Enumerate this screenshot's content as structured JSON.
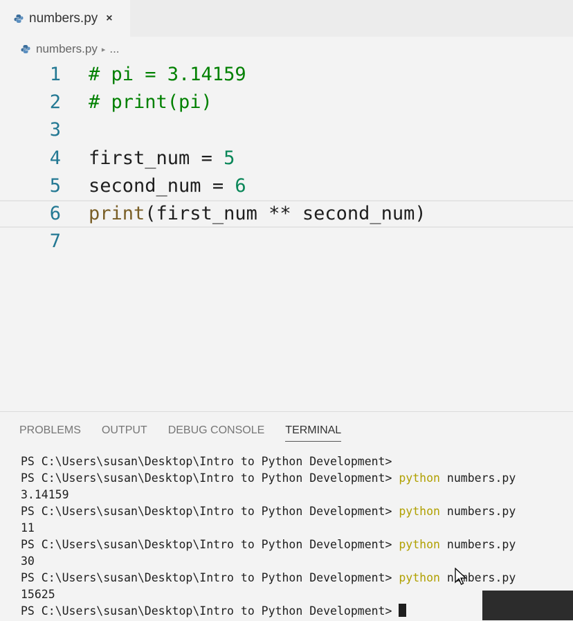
{
  "tab": {
    "filename": "numbers.py",
    "close_glyph": "×"
  },
  "breadcrumb": {
    "filename": "numbers.py",
    "separator": "▸",
    "more": "..."
  },
  "editor": {
    "lines": [
      {
        "num": "1",
        "comment": "# pi = 3.14159"
      },
      {
        "num": "2",
        "comment": "# print(pi)"
      },
      {
        "num": "3"
      },
      {
        "num": "4",
        "var": "first_num",
        "op": " = ",
        "value": "5"
      },
      {
        "num": "5",
        "var": "second_num",
        "op": " = ",
        "value": "6"
      },
      {
        "num": "6",
        "fn": "print",
        "args": "(first_num ** second_num)"
      },
      {
        "num": "7"
      }
    ]
  },
  "panel": {
    "tabs": [
      "PROBLEMS",
      "OUTPUT",
      "DEBUG CONSOLE",
      "TERMINAL"
    ],
    "active_tab": "TERMINAL"
  },
  "terminal": {
    "prompt": "PS C:\\Users\\susan\\Desktop\\Intro to Python Development>",
    "command": "python",
    "arg": "numbers.py",
    "outputs": [
      "3.14159",
      "11",
      "30",
      "15625"
    ]
  },
  "colors": {
    "comment": "#008000",
    "number": "#098658",
    "function": "#795e26",
    "command": "#b0a000",
    "line_number": "#237893"
  }
}
